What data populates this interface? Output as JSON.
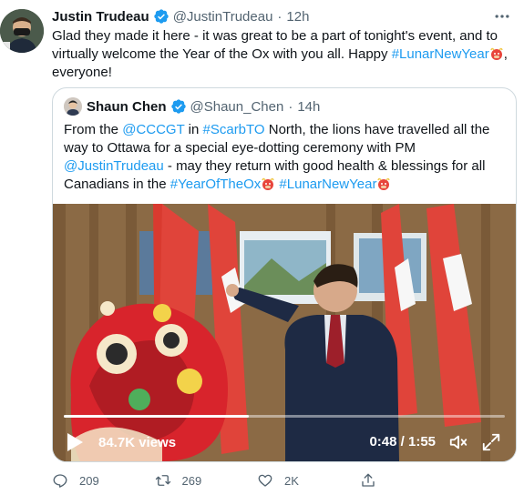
{
  "tweet": {
    "author_name": "Justin Trudeau",
    "handle": "@JustinTrudeau",
    "separator": "·",
    "time": "12h",
    "text_plain": "Glad they made it here - it was great to be a part of tonight's event, and to virtually welcome the Year of the Ox with you all. Happy ",
    "hashtag": "#LunarNewYear",
    "text_tail": ", everyone!"
  },
  "quoted": {
    "author_name": "Shaun Chen",
    "handle": "@Shaun_Chen",
    "separator": "·",
    "time": "14h",
    "text_1": "From the ",
    "mention_1": "@CCCGT",
    "text_2": " in ",
    "hashtag_1": "#ScarbTO",
    "text_3": " North, the lions have travelled all the way to Ottawa for a special eye-dotting ceremony with PM ",
    "mention_2": "@JustinTrudeau",
    "text_4": " - may they return with good health & blessings for all Canadians in the ",
    "hashtag_2": "#YearOfTheOx",
    "hashtag_3": "#LunarNewYear"
  },
  "video": {
    "views": "84.7K views",
    "time_display": "0:48 / 1:55",
    "progress": 0.42
  },
  "actions": {
    "reply_count": "209",
    "retweet_count": "269",
    "like_count": "2K"
  },
  "colors": {
    "link": "#1d9bf0",
    "verified": "#1d9bf0",
    "text": "#0f1419",
    "muted": "#536471",
    "border": "#cfd9de"
  },
  "icons": [
    "verified-badge-icon",
    "more-icon",
    "ox-emoji-icon",
    "play-icon",
    "volume-icon",
    "fullscreen-icon",
    "reply-icon",
    "retweet-icon",
    "like-icon",
    "share-icon"
  ]
}
